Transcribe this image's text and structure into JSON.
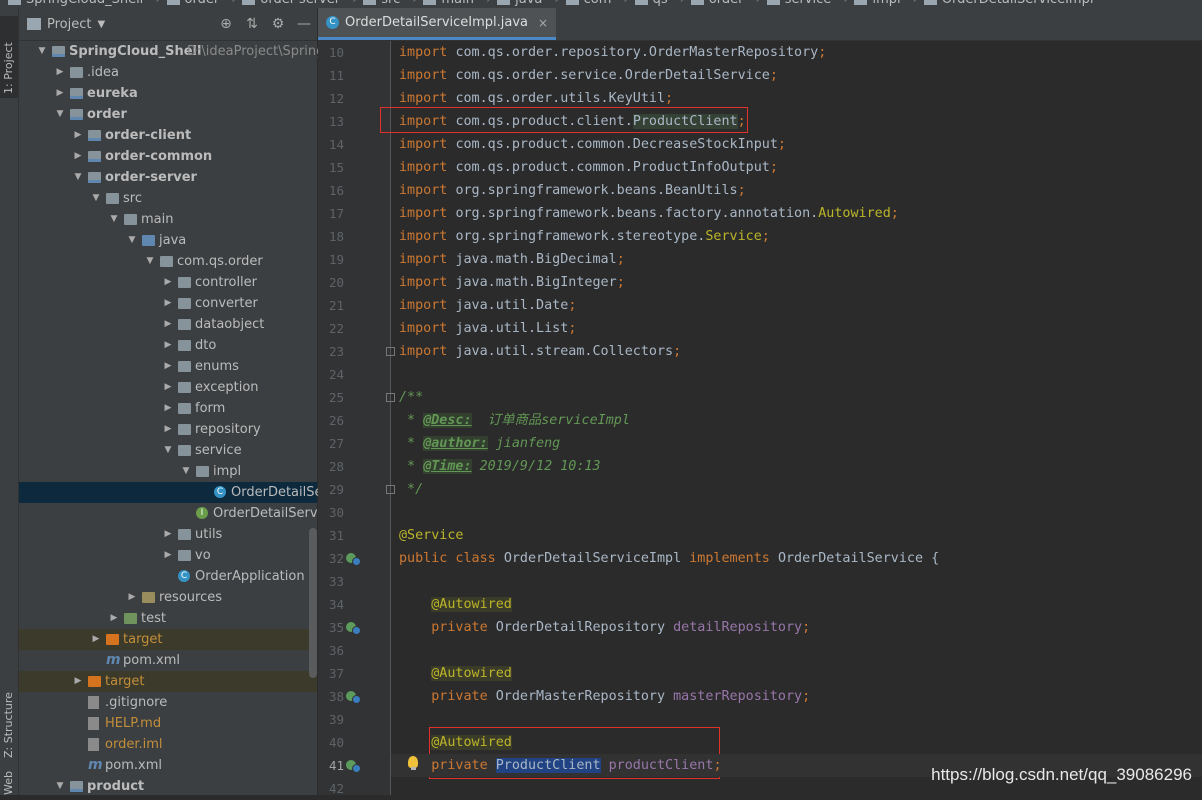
{
  "breadcrumb": [
    "SpringCloud_Shell",
    "order",
    "order-server",
    "src",
    "main",
    "java",
    "com",
    "qs",
    "order",
    "service",
    "impl",
    "OrderDetailServiceImpl"
  ],
  "toolstrip": {
    "project_tab": "1: Project",
    "structure_tab": "Z: Structure",
    "web_tab": "Web"
  },
  "project_panel": {
    "title": "Project",
    "tree": [
      {
        "label": "SpringCloud_Shell",
        "path": "D:\\ideaProject\\SpringClo",
        "depth": 0,
        "arrow": "open",
        "icon": "folder-module",
        "bold": true
      },
      {
        "label": ".idea",
        "depth": 1,
        "arrow": "closed",
        "icon": "folder"
      },
      {
        "label": "eureka",
        "depth": 1,
        "arrow": "closed",
        "icon": "folder-module",
        "bold": true
      },
      {
        "label": "order",
        "depth": 1,
        "arrow": "open",
        "icon": "folder-module",
        "bold": true
      },
      {
        "label": "order-client",
        "depth": 2,
        "arrow": "closed",
        "icon": "folder-module",
        "bold": true
      },
      {
        "label": "order-common",
        "depth": 2,
        "arrow": "closed",
        "icon": "folder-module",
        "bold": true
      },
      {
        "label": "order-server",
        "depth": 2,
        "arrow": "open",
        "icon": "folder-module",
        "bold": true
      },
      {
        "label": "src",
        "depth": 3,
        "arrow": "open",
        "icon": "folder"
      },
      {
        "label": "main",
        "depth": 4,
        "arrow": "open",
        "icon": "folder"
      },
      {
        "label": "java",
        "depth": 5,
        "arrow": "open",
        "icon": "folder-src"
      },
      {
        "label": "com.qs.order",
        "depth": 6,
        "arrow": "open",
        "icon": "folder"
      },
      {
        "label": "controller",
        "depth": 7,
        "arrow": "closed",
        "icon": "folder"
      },
      {
        "label": "converter",
        "depth": 7,
        "arrow": "closed",
        "icon": "folder"
      },
      {
        "label": "dataobject",
        "depth": 7,
        "arrow": "closed",
        "icon": "folder"
      },
      {
        "label": "dto",
        "depth": 7,
        "arrow": "closed",
        "icon": "folder"
      },
      {
        "label": "enums",
        "depth": 7,
        "arrow": "closed",
        "icon": "folder"
      },
      {
        "label": "exception",
        "depth": 7,
        "arrow": "closed",
        "icon": "folder"
      },
      {
        "label": "form",
        "depth": 7,
        "arrow": "closed",
        "icon": "folder"
      },
      {
        "label": "repository",
        "depth": 7,
        "arrow": "closed",
        "icon": "folder"
      },
      {
        "label": "service",
        "depth": 7,
        "arrow": "open",
        "icon": "folder"
      },
      {
        "label": "impl",
        "depth": 8,
        "arrow": "open",
        "icon": "folder"
      },
      {
        "label": "OrderDetailServic",
        "depth": 9,
        "arrow": "none",
        "icon": "class",
        "selected": true
      },
      {
        "label": "OrderDetailService",
        "depth": 8,
        "arrow": "none",
        "icon": "interface"
      },
      {
        "label": "utils",
        "depth": 7,
        "arrow": "closed",
        "icon": "folder"
      },
      {
        "label": "vo",
        "depth": 7,
        "arrow": "closed",
        "icon": "folder"
      },
      {
        "label": "OrderApplication",
        "depth": 7,
        "arrow": "none",
        "icon": "app"
      },
      {
        "label": "resources",
        "depth": 5,
        "arrow": "closed",
        "icon": "folder-res"
      },
      {
        "label": "test",
        "depth": 4,
        "arrow": "closed",
        "icon": "folder-test"
      },
      {
        "label": "target",
        "depth": 3,
        "arrow": "closed",
        "icon": "folder-target",
        "orange": true,
        "highlight": true
      },
      {
        "label": "pom.xml",
        "depth": 3,
        "arrow": "none",
        "icon": "maven"
      },
      {
        "label": "target",
        "depth": 2,
        "arrow": "closed",
        "icon": "folder-target",
        "orange": true,
        "highlight": true
      },
      {
        "label": ".gitignore",
        "depth": 2,
        "arrow": "none",
        "icon": "file"
      },
      {
        "label": "HELP.md",
        "depth": 2,
        "arrow": "none",
        "icon": "file",
        "orange": true
      },
      {
        "label": "order.iml",
        "depth": 2,
        "arrow": "none",
        "icon": "file",
        "orange": true
      },
      {
        "label": "pom.xml",
        "depth": 2,
        "arrow": "none",
        "icon": "maven"
      },
      {
        "label": "product",
        "depth": 1,
        "arrow": "open",
        "icon": "folder-module",
        "bold": true
      }
    ]
  },
  "editor": {
    "tab": {
      "label": "OrderDetailServiceImpl.java",
      "close": "×"
    },
    "current_line": 41,
    "lines": [
      {
        "n": "10",
        "t": [
          [
            "kw",
            "import "
          ],
          [
            "p",
            "com.qs.order.repository.OrderMasterRepository"
          ],
          [
            "kw",
            ";"
          ]
        ]
      },
      {
        "n": "11",
        "t": [
          [
            "kw",
            "import "
          ],
          [
            "p",
            "com.qs.order.service.OrderDetailService"
          ],
          [
            "kw",
            ";"
          ]
        ]
      },
      {
        "n": "12",
        "t": [
          [
            "kw",
            "import "
          ],
          [
            "p",
            "com.qs.order.utils.KeyUtil"
          ],
          [
            "kw",
            ";"
          ]
        ]
      },
      {
        "n": "13",
        "t": [
          [
            "kw",
            "import "
          ],
          [
            "p",
            "com.qs.product.client."
          ],
          [
            "impcls",
            "ProductClient"
          ],
          [
            "kw",
            ";"
          ]
        ]
      },
      {
        "n": "14",
        "t": [
          [
            "kw",
            "import "
          ],
          [
            "p",
            "com.qs.product.common.DecreaseStockInput"
          ],
          [
            "kw",
            ";"
          ]
        ]
      },
      {
        "n": "15",
        "t": [
          [
            "kw",
            "import "
          ],
          [
            "p",
            "com.qs.product.common.ProductInfoOutput"
          ],
          [
            "kw",
            ";"
          ]
        ]
      },
      {
        "n": "16",
        "t": [
          [
            "kw",
            "import "
          ],
          [
            "p",
            "org.springframework.beans.BeanUtils"
          ],
          [
            "kw",
            ";"
          ]
        ]
      },
      {
        "n": "17",
        "t": [
          [
            "kw",
            "import "
          ],
          [
            "p",
            "org.springframework.beans.factory.annotation."
          ],
          [
            "ann",
            "Autowired"
          ],
          [
            "kw",
            ";"
          ]
        ]
      },
      {
        "n": "18",
        "t": [
          [
            "kw",
            "import "
          ],
          [
            "p",
            "org.springframework.stereotype."
          ],
          [
            "ann",
            "Service"
          ],
          [
            "kw",
            ";"
          ]
        ]
      },
      {
        "n": "19",
        "t": [
          [
            "kw",
            "import "
          ],
          [
            "p",
            "java.math.BigDecimal"
          ],
          [
            "kw",
            ";"
          ]
        ]
      },
      {
        "n": "20",
        "t": [
          [
            "kw",
            "import "
          ],
          [
            "p",
            "java.math.BigInteger"
          ],
          [
            "kw",
            ";"
          ]
        ]
      },
      {
        "n": "21",
        "t": [
          [
            "kw",
            "import "
          ],
          [
            "p",
            "java.util.Date"
          ],
          [
            "kw",
            ";"
          ]
        ]
      },
      {
        "n": "22",
        "t": [
          [
            "kw",
            "import "
          ],
          [
            "p",
            "java.util.List"
          ],
          [
            "kw",
            ";"
          ]
        ]
      },
      {
        "n": "23",
        "t": [
          [
            "kw",
            "import "
          ],
          [
            "p",
            "java.util.stream.Collectors"
          ],
          [
            "kw",
            ";"
          ]
        ]
      },
      {
        "n": "24",
        "t": []
      },
      {
        "n": "25",
        "t": [
          [
            "doc",
            "/**"
          ]
        ]
      },
      {
        "n": "26",
        "t": [
          [
            "doc",
            " * "
          ],
          [
            "doctag",
            "@Desc:"
          ],
          [
            "doc",
            "  订单商品serviceImpl"
          ]
        ]
      },
      {
        "n": "27",
        "t": [
          [
            "doc",
            " * "
          ],
          [
            "doctag",
            "@author:"
          ],
          [
            "doc",
            " jianfeng"
          ]
        ]
      },
      {
        "n": "28",
        "t": [
          [
            "doc",
            " * "
          ],
          [
            "doctag",
            "@Time:"
          ],
          [
            "doc",
            " 2019/9/12 10:13"
          ]
        ]
      },
      {
        "n": "29",
        "t": [
          [
            "doc",
            " */"
          ]
        ]
      },
      {
        "n": "30",
        "t": []
      },
      {
        "n": "31",
        "t": [
          [
            "ann",
            "@Service"
          ]
        ]
      },
      {
        "n": "32",
        "t": [
          [
            "kw",
            "public class "
          ],
          [
            "p",
            "OrderDetailServiceImpl "
          ],
          [
            "kw",
            "implements "
          ],
          [
            "p",
            "OrderDetailService {"
          ]
        ]
      },
      {
        "n": "33",
        "t": []
      },
      {
        "n": "34",
        "t": [
          [
            "p",
            "    "
          ],
          [
            "annbg",
            "@Autowired"
          ]
        ]
      },
      {
        "n": "35",
        "t": [
          [
            "p",
            "    "
          ],
          [
            "kw",
            "private "
          ],
          [
            "p",
            "OrderDetailRepository "
          ],
          [
            "fld",
            "detailRepository"
          ],
          [
            "kw",
            ";"
          ]
        ]
      },
      {
        "n": "36",
        "t": []
      },
      {
        "n": "37",
        "t": [
          [
            "p",
            "    "
          ],
          [
            "annbg",
            "@Autowired"
          ]
        ]
      },
      {
        "n": "38",
        "t": [
          [
            "p",
            "    "
          ],
          [
            "kw",
            "private "
          ],
          [
            "p",
            "OrderMasterRepository "
          ],
          [
            "fld",
            "masterRepository"
          ],
          [
            "kw",
            ";"
          ]
        ]
      },
      {
        "n": "39",
        "t": []
      },
      {
        "n": "40",
        "t": [
          [
            "p",
            "    "
          ],
          [
            "annbg",
            "@Autowired"
          ]
        ]
      },
      {
        "n": "41",
        "t": [
          [
            "p",
            "    "
          ],
          [
            "kw",
            "private "
          ],
          [
            "selw",
            "ProductClient"
          ],
          [
            "p",
            " "
          ],
          [
            "fld",
            "productClient"
          ],
          [
            "kw",
            ";"
          ]
        ]
      },
      {
        "n": "42",
        "t": []
      }
    ]
  },
  "watermark": "https://blog.csdn.net/qq_39086296",
  "colors": {
    "accent_tab": "#4a88c7",
    "highlight_box": "#e0312c",
    "selection_row": "#0d293e"
  }
}
